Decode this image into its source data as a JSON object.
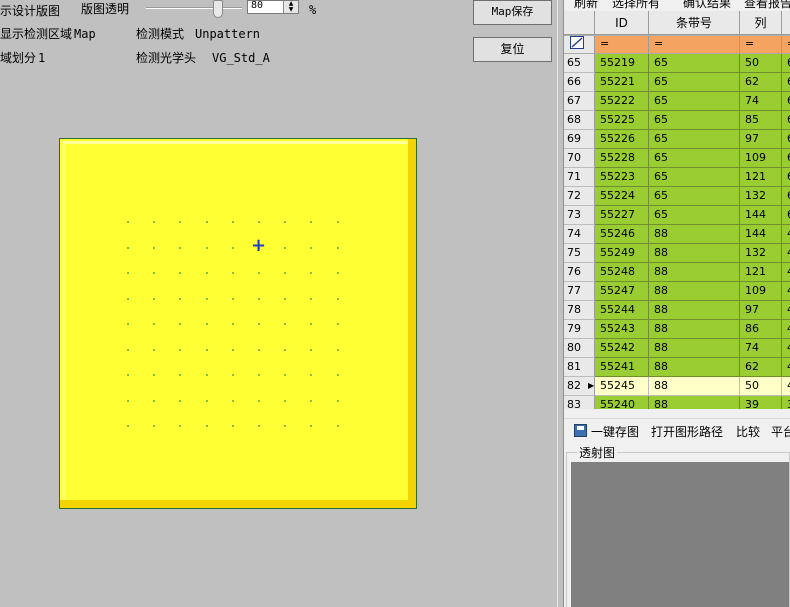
{
  "left_panel": {
    "show_design_map_label": "示设计版图",
    "map_transparency_label": "版图透明",
    "transparency_value": "80",
    "transparency_unit": "%",
    "show_detect_region_label": "显示检测区域",
    "show_detect_region_value": "Map",
    "detect_mode_label": "检测模式",
    "detect_mode_value": "Unpattern",
    "region_division_label": "域划分",
    "region_division_value": "1",
    "optical_head_label": "检测光学头",
    "optical_head_value": "VG_Std_A",
    "map_save_button": "Map保存",
    "reset_button": "复位"
  },
  "wafer_map": {
    "fill_color": "#ffff33",
    "dot_color": "#7fc241",
    "dot_rows": 9,
    "dot_cols": 9
  },
  "right_panel": {
    "top_toolbar": [
      "刷新",
      "选择所有",
      "确认结果",
      "查看报告"
    ],
    "grid": {
      "columns": [
        "ID",
        "条带号",
        "列"
      ],
      "filter_symbol": "=",
      "rows": [
        {
          "idx": "65",
          "id": "55219",
          "strip": "65",
          "col": "50",
          "extra": "6"
        },
        {
          "idx": "66",
          "id": "55221",
          "strip": "65",
          "col": "62",
          "extra": "6"
        },
        {
          "idx": "67",
          "id": "55222",
          "strip": "65",
          "col": "74",
          "extra": "6"
        },
        {
          "idx": "68",
          "id": "55225",
          "strip": "65",
          "col": "85",
          "extra": "6"
        },
        {
          "idx": "69",
          "id": "55226",
          "strip": "65",
          "col": "97",
          "extra": "6"
        },
        {
          "idx": "70",
          "id": "55228",
          "strip": "65",
          "col": "109",
          "extra": "6"
        },
        {
          "idx": "71",
          "id": "55223",
          "strip": "65",
          "col": "121",
          "extra": "6"
        },
        {
          "idx": "72",
          "id": "55224",
          "strip": "65",
          "col": "132",
          "extra": "6"
        },
        {
          "idx": "73",
          "id": "55227",
          "strip": "65",
          "col": "144",
          "extra": "6"
        },
        {
          "idx": "74",
          "id": "55246",
          "strip": "88",
          "col": "144",
          "extra": "4"
        },
        {
          "idx": "75",
          "id": "55249",
          "strip": "88",
          "col": "132",
          "extra": "4"
        },
        {
          "idx": "76",
          "id": "55248",
          "strip": "88",
          "col": "121",
          "extra": "4"
        },
        {
          "idx": "77",
          "id": "55247",
          "strip": "88",
          "col": "109",
          "extra": "4"
        },
        {
          "idx": "78",
          "id": "55244",
          "strip": "88",
          "col": "97",
          "extra": "4"
        },
        {
          "idx": "79",
          "id": "55243",
          "strip": "88",
          "col": "86",
          "extra": "4"
        },
        {
          "idx": "80",
          "id": "55242",
          "strip": "88",
          "col": "74",
          "extra": "4"
        },
        {
          "idx": "81",
          "id": "55241",
          "strip": "88",
          "col": "62",
          "extra": "4"
        },
        {
          "idx": "82",
          "id": "55245",
          "strip": "88",
          "col": "50",
          "extra": "4"
        },
        {
          "idx": "83",
          "id": "55240",
          "strip": "88",
          "col": "39",
          "extra": "3"
        }
      ],
      "selected_row_index": 17,
      "row_color": "#9acd32",
      "selected_color": "#ffffc8",
      "filter_color": "#f4a460"
    },
    "bottom_toolbar": {
      "save_all": "一键存图",
      "open_path": "打开图形路径",
      "compare": "比较",
      "platform": "平台"
    },
    "preview_group_title": "透射图"
  }
}
